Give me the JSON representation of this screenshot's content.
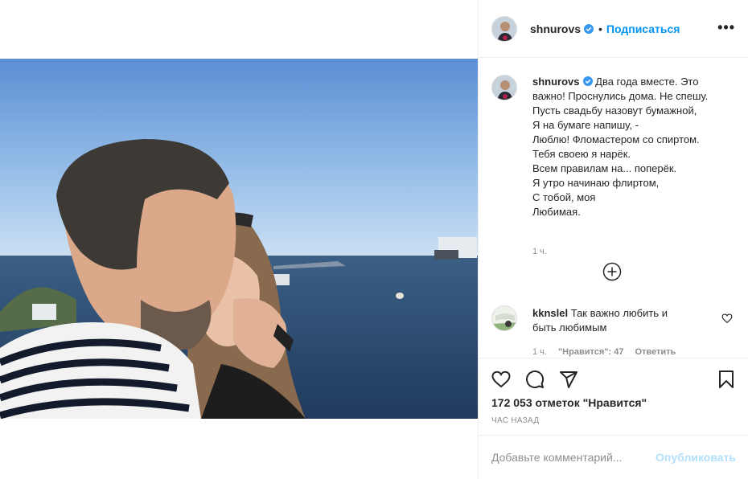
{
  "post": {
    "username": "shnurovs",
    "follow_label": "Подписаться",
    "separator": "•",
    "more_label": "•••",
    "caption_lead": "Два года вместе. Это важно! Проснулись дома. Не спешу.",
    "caption_poem": "Пусть свадьбу назовут бумажной,\nЯ на бумаге напишу, -\nЛюблю! Фломастером со спиртом.\nТебя своею я нарёк.\nВсем правилам на... поперёк.\nЯ утро начинаю флиртом,\nС тобой, моя\nЛюбимая.",
    "caption_time": "1 ч.",
    "likes": "172 053 отметок \"Нравится\"",
    "timestamp": "час назад"
  },
  "comment": {
    "username": "kknslel",
    "text": "Так важно любить и быть любимым",
    "time": "1 ч.",
    "likes": "\"Нравится\": 47",
    "reply_label": "Ответить"
  },
  "compose": {
    "placeholder": "Добавьте комментарий...",
    "publish_label": "Опубликовать"
  },
  "icons": {
    "verified": "verified-badge-icon",
    "load_more": "plus-circle-icon",
    "like": "heart-icon",
    "comment": "comment-bubble-icon",
    "share": "paper-plane-icon",
    "save": "bookmark-icon"
  },
  "colors": {
    "accent": "#0095f6",
    "publish_disabled": "#b2dffc",
    "secondary_text": "#8e8e8e",
    "border": "#efefef"
  }
}
